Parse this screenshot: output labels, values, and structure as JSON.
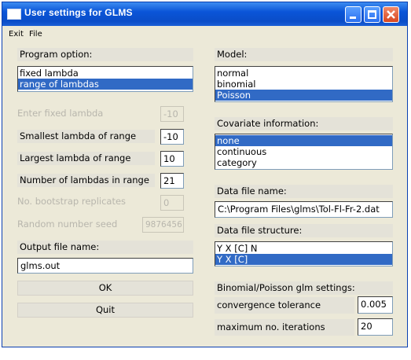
{
  "window": {
    "title": "User settings for GLMS"
  },
  "menu": {
    "items": [
      "Exit",
      "File"
    ]
  },
  "left": {
    "program_option_label": "Program option:",
    "program_options": [
      {
        "label": "fixed lambda",
        "selected": false
      },
      {
        "label": "range of lambdas",
        "selected": true
      }
    ],
    "fixed_lambda": {
      "label": "Enter fixed lambda",
      "value": "-10"
    },
    "smallest_lambda": {
      "label": "Smallest lambda of range",
      "value": "-10"
    },
    "largest_lambda": {
      "label": "Largest lambda of range",
      "value": "10"
    },
    "num_lambdas": {
      "label": "Number of lambdas in range",
      "value": "21"
    },
    "bootstrap": {
      "label": "No. bootstrap replicates",
      "value": "0"
    },
    "seed": {
      "label": "Random number seed",
      "value": "9876456"
    },
    "output_label": "Output file name:",
    "output_value": "glms.out",
    "ok_label": "OK",
    "quit_label": "Quit"
  },
  "right": {
    "model_label": "Model:",
    "models": [
      {
        "label": "normal",
        "selected": false
      },
      {
        "label": "binomial",
        "selected": false
      },
      {
        "label": "Poisson",
        "selected": true
      }
    ],
    "covariate_label": "Covariate information:",
    "covariates": [
      {
        "label": "none",
        "selected": true
      },
      {
        "label": "continuous",
        "selected": false
      },
      {
        "label": "category",
        "selected": false
      }
    ],
    "data_file_label": "Data file name:",
    "data_file_value": "C:\\Program Files\\glms\\Tol-Fl-Fr-2.dat",
    "structure_label": "Data file structure:",
    "structures": [
      {
        "label": "Y X [C] N",
        "selected": false
      },
      {
        "label": "Y X [C]",
        "selected": true
      }
    ],
    "glm_settings_label": "Binomial/Poisson glm settings:",
    "tolerance": {
      "label": "convergence tolerance",
      "value": "0.005"
    },
    "iterations": {
      "label": "maximum no. iterations",
      "value": "20"
    }
  },
  "colors": {
    "selection": "#316ac5",
    "titlebar": "#0a55d8",
    "panel": "#ece9d8"
  }
}
